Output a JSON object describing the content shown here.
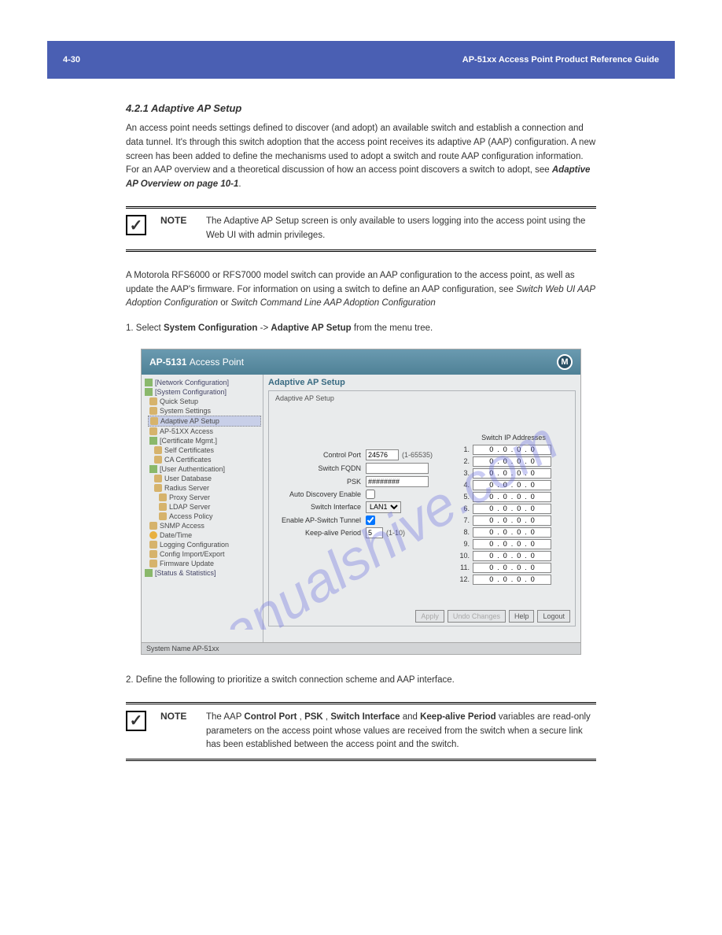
{
  "header": {
    "left": "4-30",
    "right": "AP-51xx Access Point Product Reference Guide"
  },
  "section_title": "4.2.1 Adaptive AP Setup",
  "para1_a": "An access point needs settings defined to discover (and adopt) an available switch and establish a connection and data tunnel. It's through this switch adoption that the access point receives its adaptive AP (AAP) configuration. A new screen has been added to define the mechanisms used to adopt a switch and route AAP configuration information. For an AAP overview and a theoretical discussion of how an access point discovers a switch to adopt, see ",
  "para1_linktext": "Adaptive AP Overview on page 10-1",
  "note1": {
    "label": "NOTE",
    "text": "The Adaptive AP Setup screen is only available to users logging into the access point using the Web UI with admin privileges."
  },
  "para2_a": "A Motorola RFS6000 or RFS7000 model switch can provide an AAP configuration to the access point, as well as update the AAP's firmware. For information on using a switch to define an AAP configuration, see ",
  "para2_linktext": "Switch Web UI AAP Adoption Configuration",
  "para2_b": "or",
  "para2_linktext2": "Switch Command Line AAP Adoption Configuration",
  "steps": {
    "s1a": "1.    Select ",
    "s1b": "System Configuration",
    "s1c": " -> ",
    "s1d": "Adaptive AP Setup",
    "s1e": " from the menu tree."
  },
  "app": {
    "title_a": "AP-5131 ",
    "title_b": "Access Point",
    "nav": {
      "network": "[Network Configuration]",
      "system": "[System Configuration]",
      "quick": "Quick Setup",
      "settings": "System Settings",
      "adaptive": "Adaptive AP Setup",
      "apaccess": "AP-51XX Access",
      "cert": "[Certificate Mgmt.]",
      "selfcert": "Self Certificates",
      "cacert": "CA Certificates",
      "userauth": "[User Authentication]",
      "userdb": "User Database",
      "radius": "Radius Server",
      "proxy": "Proxy Server",
      "ldap": "LDAP Server",
      "accesspolicy": "Access Policy",
      "snmp": "SNMP Access",
      "datetime": "Date/Time",
      "logging": "Logging Configuration",
      "configie": "Config Import/Export",
      "firmware": "Firmware Update",
      "status": "[Status & Statistics]"
    },
    "panel_title": "Adaptive AP Setup",
    "panel_subtitle": "Adaptive AP Setup",
    "form": {
      "control_port_label": "Control Port",
      "control_port_value": "24576",
      "control_port_hint": "(1-65535)",
      "fqdn_label": "Switch FQDN",
      "fqdn_value": "",
      "psk_label": "PSK",
      "psk_value": "########",
      "autodisc_label": "Auto Discovery Enable",
      "switchif_label": "Switch Interface",
      "switchif_value": "LAN1",
      "tunnel_label": "Enable AP-Switch Tunnel",
      "keepalive_label": "Keep-alive Period",
      "keepalive_value": "5",
      "keepalive_hint": "(1-10)"
    },
    "ip_header": "Switch IP Addresses",
    "ip_labels": [
      "1.",
      "2.",
      "3.",
      "4.",
      "5.",
      "6.",
      "7.",
      "8.",
      "9.",
      "10.",
      "11.",
      "12."
    ],
    "ip_value": "0  .  0  .  0  .  0",
    "buttons": {
      "apply": "Apply",
      "undo": "Undo Changes",
      "help": "Help",
      "logout": "Logout"
    },
    "status": "System Name AP-51xx"
  },
  "step2_a": "2.    Define the following to prioritize a switch connection scheme and AAP interface.",
  "note2": {
    "label": "NOTE",
    "text_a": "The AAP ",
    "text_b": "Control Port",
    "text_c": ", ",
    "text_d": "PSK",
    "text_e": ", ",
    "text_f": "Switch Interface",
    "text_g": " and ",
    "text_h": "Keep-alive Period",
    "text_i": " variables are read-only parameters on the access point whose values are received from the switch when a secure link has been established between the access point and the switch."
  },
  "watermark_text": "manualshive.com"
}
